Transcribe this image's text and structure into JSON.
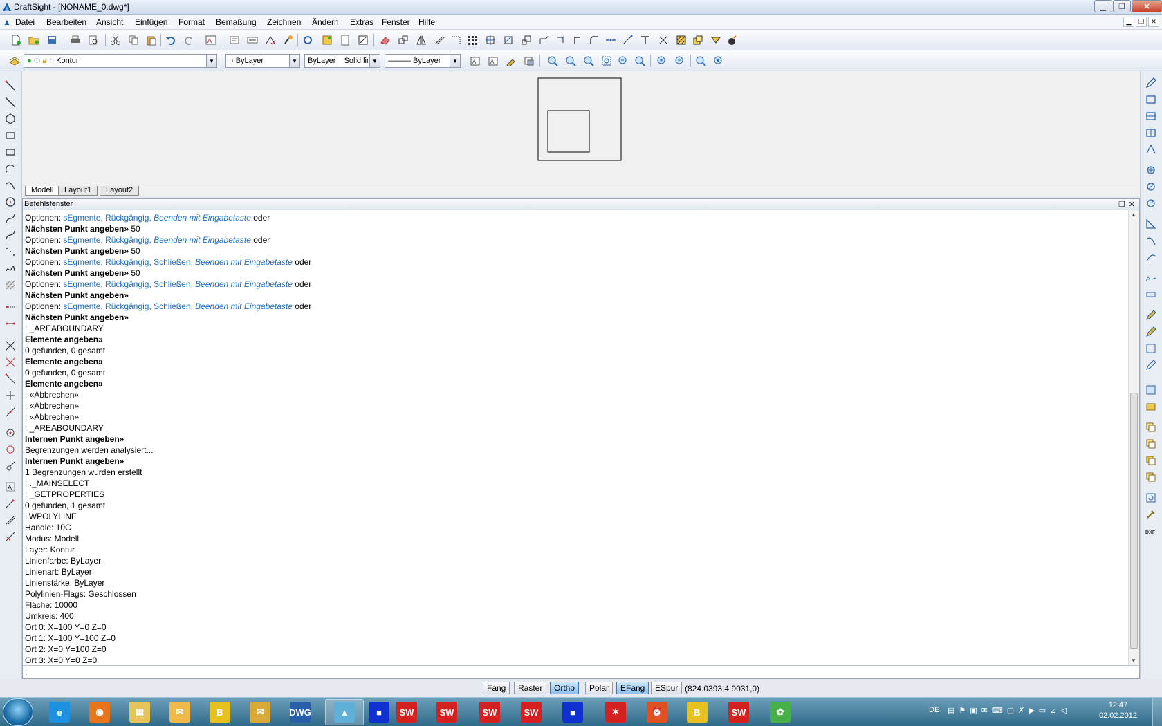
{
  "window": {
    "title": "DraftSight - [NONAME_0.dwg*]"
  },
  "menu": [
    "Datei",
    "Bearbeiten",
    "Ansicht",
    "Einfügen",
    "Format",
    "Bemaßung",
    "Zeichnen",
    "Ändern",
    "Extras",
    "Fenster",
    "Hilfe"
  ],
  "props": {
    "layer": "Kontur",
    "color": "ByLayer",
    "linestyle_a": "ByLayer",
    "linestyle_b": "Solid line",
    "lineweight": "——— ByLayer"
  },
  "tabs": [
    "Modell",
    "Layout1",
    "Layout2"
  ],
  "command_window": {
    "title": "Befehlsfenster",
    "input_prompt": ":",
    "lines": [
      "Optionen: sEgmente, Rückgängig, Beenden mit Eingabetaste oder",
      "Nächsten Punkt angeben» 50",
      "Optionen: sEgmente, Rückgängig, Beenden mit Eingabetaste oder",
      "Nächsten Punkt angeben» 50",
      "Optionen: sEgmente, Rückgängig, Schließen, Beenden mit Eingabetaste oder",
      "Nächsten Punkt angeben» 50",
      "Optionen: sEgmente, Rückgängig, Schließen, Beenden mit Eingabetaste oder",
      "Nächsten Punkt angeben»",
      "Optionen: sEgmente, Rückgängig, Schließen, Beenden mit Eingabetaste oder",
      "Nächsten Punkt angeben»",
      ": _AREABOUNDARY",
      "Elemente angeben»",
      "0 gefunden, 0 gesamt",
      "Elemente angeben»",
      "0 gefunden, 0 gesamt",
      "Elemente angeben»",
      ": «Abbrechen»",
      ": «Abbrechen»",
      ": «Abbrechen»",
      ": _AREABOUNDARY",
      "Internen Punkt angeben»",
      "Begrenzungen werden analysiert...",
      "Internen Punkt angeben»",
      "1 Begrenzungen wurden erstellt",
      ": ._MAINSELECT",
      ": _GETPROPERTIES",
      "0 gefunden, 1 gesamt",
      "LWPOLYLINE",
      "Handle: 10C",
      "Modus: Modell",
      "Layer: Kontur",
      "Linienfarbe: ByLayer",
      "Linienart: ByLayer",
      "Linienstärke: ByLayer",
      "Polylinien-Flags: Geschlossen",
      "Fläche: 10000",
      "Umkreis: 400",
      "Ort 0: X=100 Y=0 Z=0",
      "Ort 1: X=100 Y=100 Z=0",
      "Ort 2: X=0 Y=100 Z=0",
      "Ort 3: X=0 Y=0 Z=0"
    ]
  },
  "status": {
    "buttons": [
      {
        "label": "Fang",
        "active": false
      },
      {
        "label": "Raster",
        "active": false
      },
      {
        "label": "Ortho",
        "active": true
      },
      {
        "label": "Polar",
        "active": false
      },
      {
        "label": "EFang",
        "active": true
      },
      {
        "label": "ESpur",
        "active": false
      }
    ],
    "coordinates": "(824.0393,4.9031,0)"
  },
  "taskbar": {
    "apps": [
      "ie-icon",
      "firefox-icon",
      "explorer-icon",
      "outlook-icon",
      "b-icon",
      "mail-icon",
      "dwg-icon",
      "draftsight-icon",
      "trumpf-icon",
      "solidworks-icon",
      "solidworks-icon",
      "solidworks-icon",
      "solidworks-icon",
      "trumpf-icon",
      "splash-icon",
      "alarm-clock-icon",
      "b-icon",
      "solidworks-icon",
      "colorful-icon"
    ],
    "language": "DE",
    "time": "12:47",
    "date": "02.02.2012"
  },
  "colors": {
    "accent": "#1f6fc0",
    "status_active": "#8fc2ee"
  }
}
